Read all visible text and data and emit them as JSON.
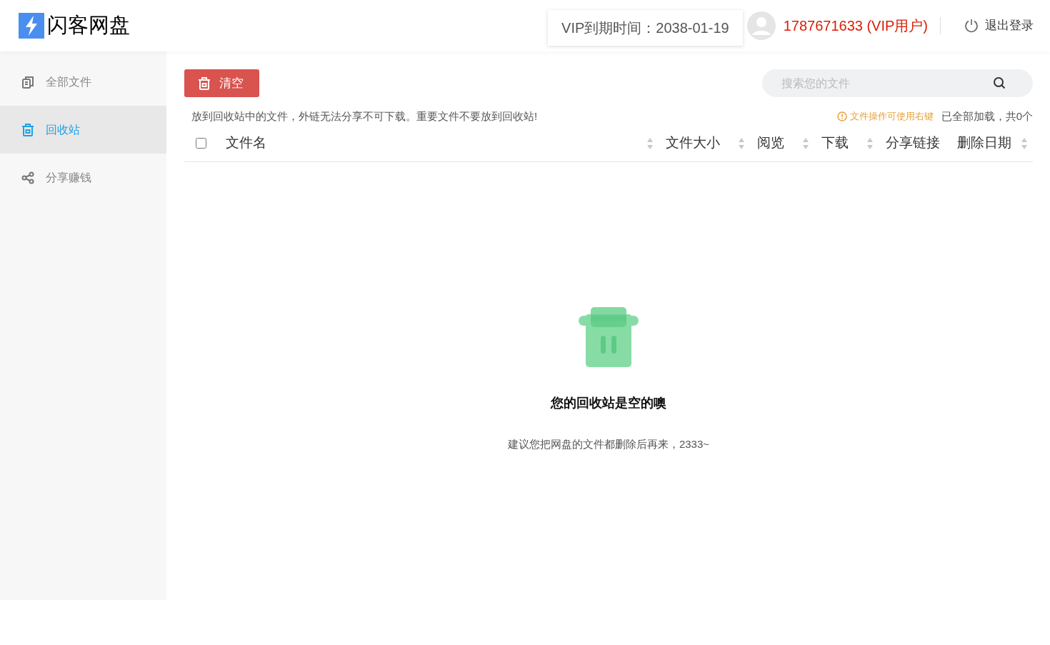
{
  "header": {
    "logo": "闪客网盘",
    "vip_expiry": "VIP到期时间：2038-01-19",
    "user": "1787671633 (VIP用户)",
    "logout": "退出登录"
  },
  "sidebar": {
    "items": [
      {
        "label": "全部文件",
        "kind": "files",
        "selected": false
      },
      {
        "label": "回收站",
        "kind": "trash",
        "selected": true
      },
      {
        "label": "分享赚钱",
        "kind": "share",
        "selected": false
      }
    ]
  },
  "toolbar": {
    "clear_button": "清空",
    "search": {
      "placeholder": "搜索您的文件"
    }
  },
  "notice": "放到回收站中的文件，外链无法分享不可下载。重要文件不要放到回收站!",
  "tip": "文件操作可使用右键",
  "load_status": "已全部加载，共0个",
  "table": {
    "select_all": {
      "checked": false
    },
    "columns": [
      {
        "label": "文件名",
        "sortable": true
      },
      {
        "label": "文件大小",
        "sortable": true
      },
      {
        "label": "阅览",
        "sortable": true
      },
      {
        "label": "下载",
        "sortable": true
      },
      {
        "label": "分享链接",
        "sortable": false
      },
      {
        "label": "删除日期",
        "sortable": true
      }
    ]
  },
  "empty_state": {
    "title": "您的回收站是空的噢",
    "subtitle": "建议您把网盘的文件都删除后再来，2333~"
  }
}
